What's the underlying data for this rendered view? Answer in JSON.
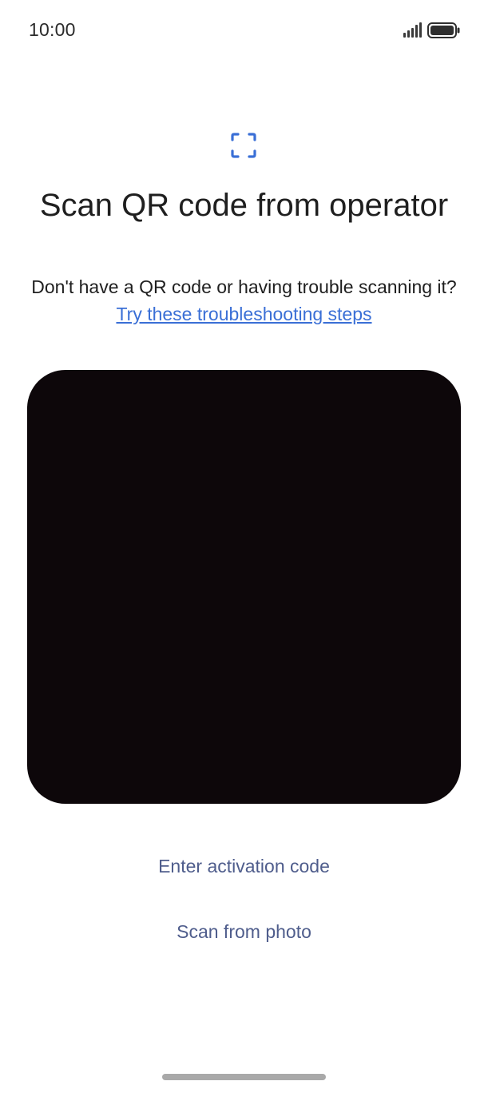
{
  "status_bar": {
    "time": "10:00",
    "icons": [
      "signal-icon",
      "battery-icon"
    ]
  },
  "header": {
    "icon": "qr-scan-frame-icon",
    "title": "Scan QR code from operator",
    "subtitle_text": "Don't have a QR code or having trouble scanning it? ",
    "help_link": "Try these troubleshooting steps"
  },
  "camera": {
    "background": "#0d070a"
  },
  "actions": {
    "enter_code_label": "Enter activation code",
    "scan_photo_label": "Scan from photo"
  },
  "colors": {
    "accent_blue": "#3a6fd6",
    "button_text": "#4f5d8c",
    "title_text": "#1f1f1f"
  }
}
